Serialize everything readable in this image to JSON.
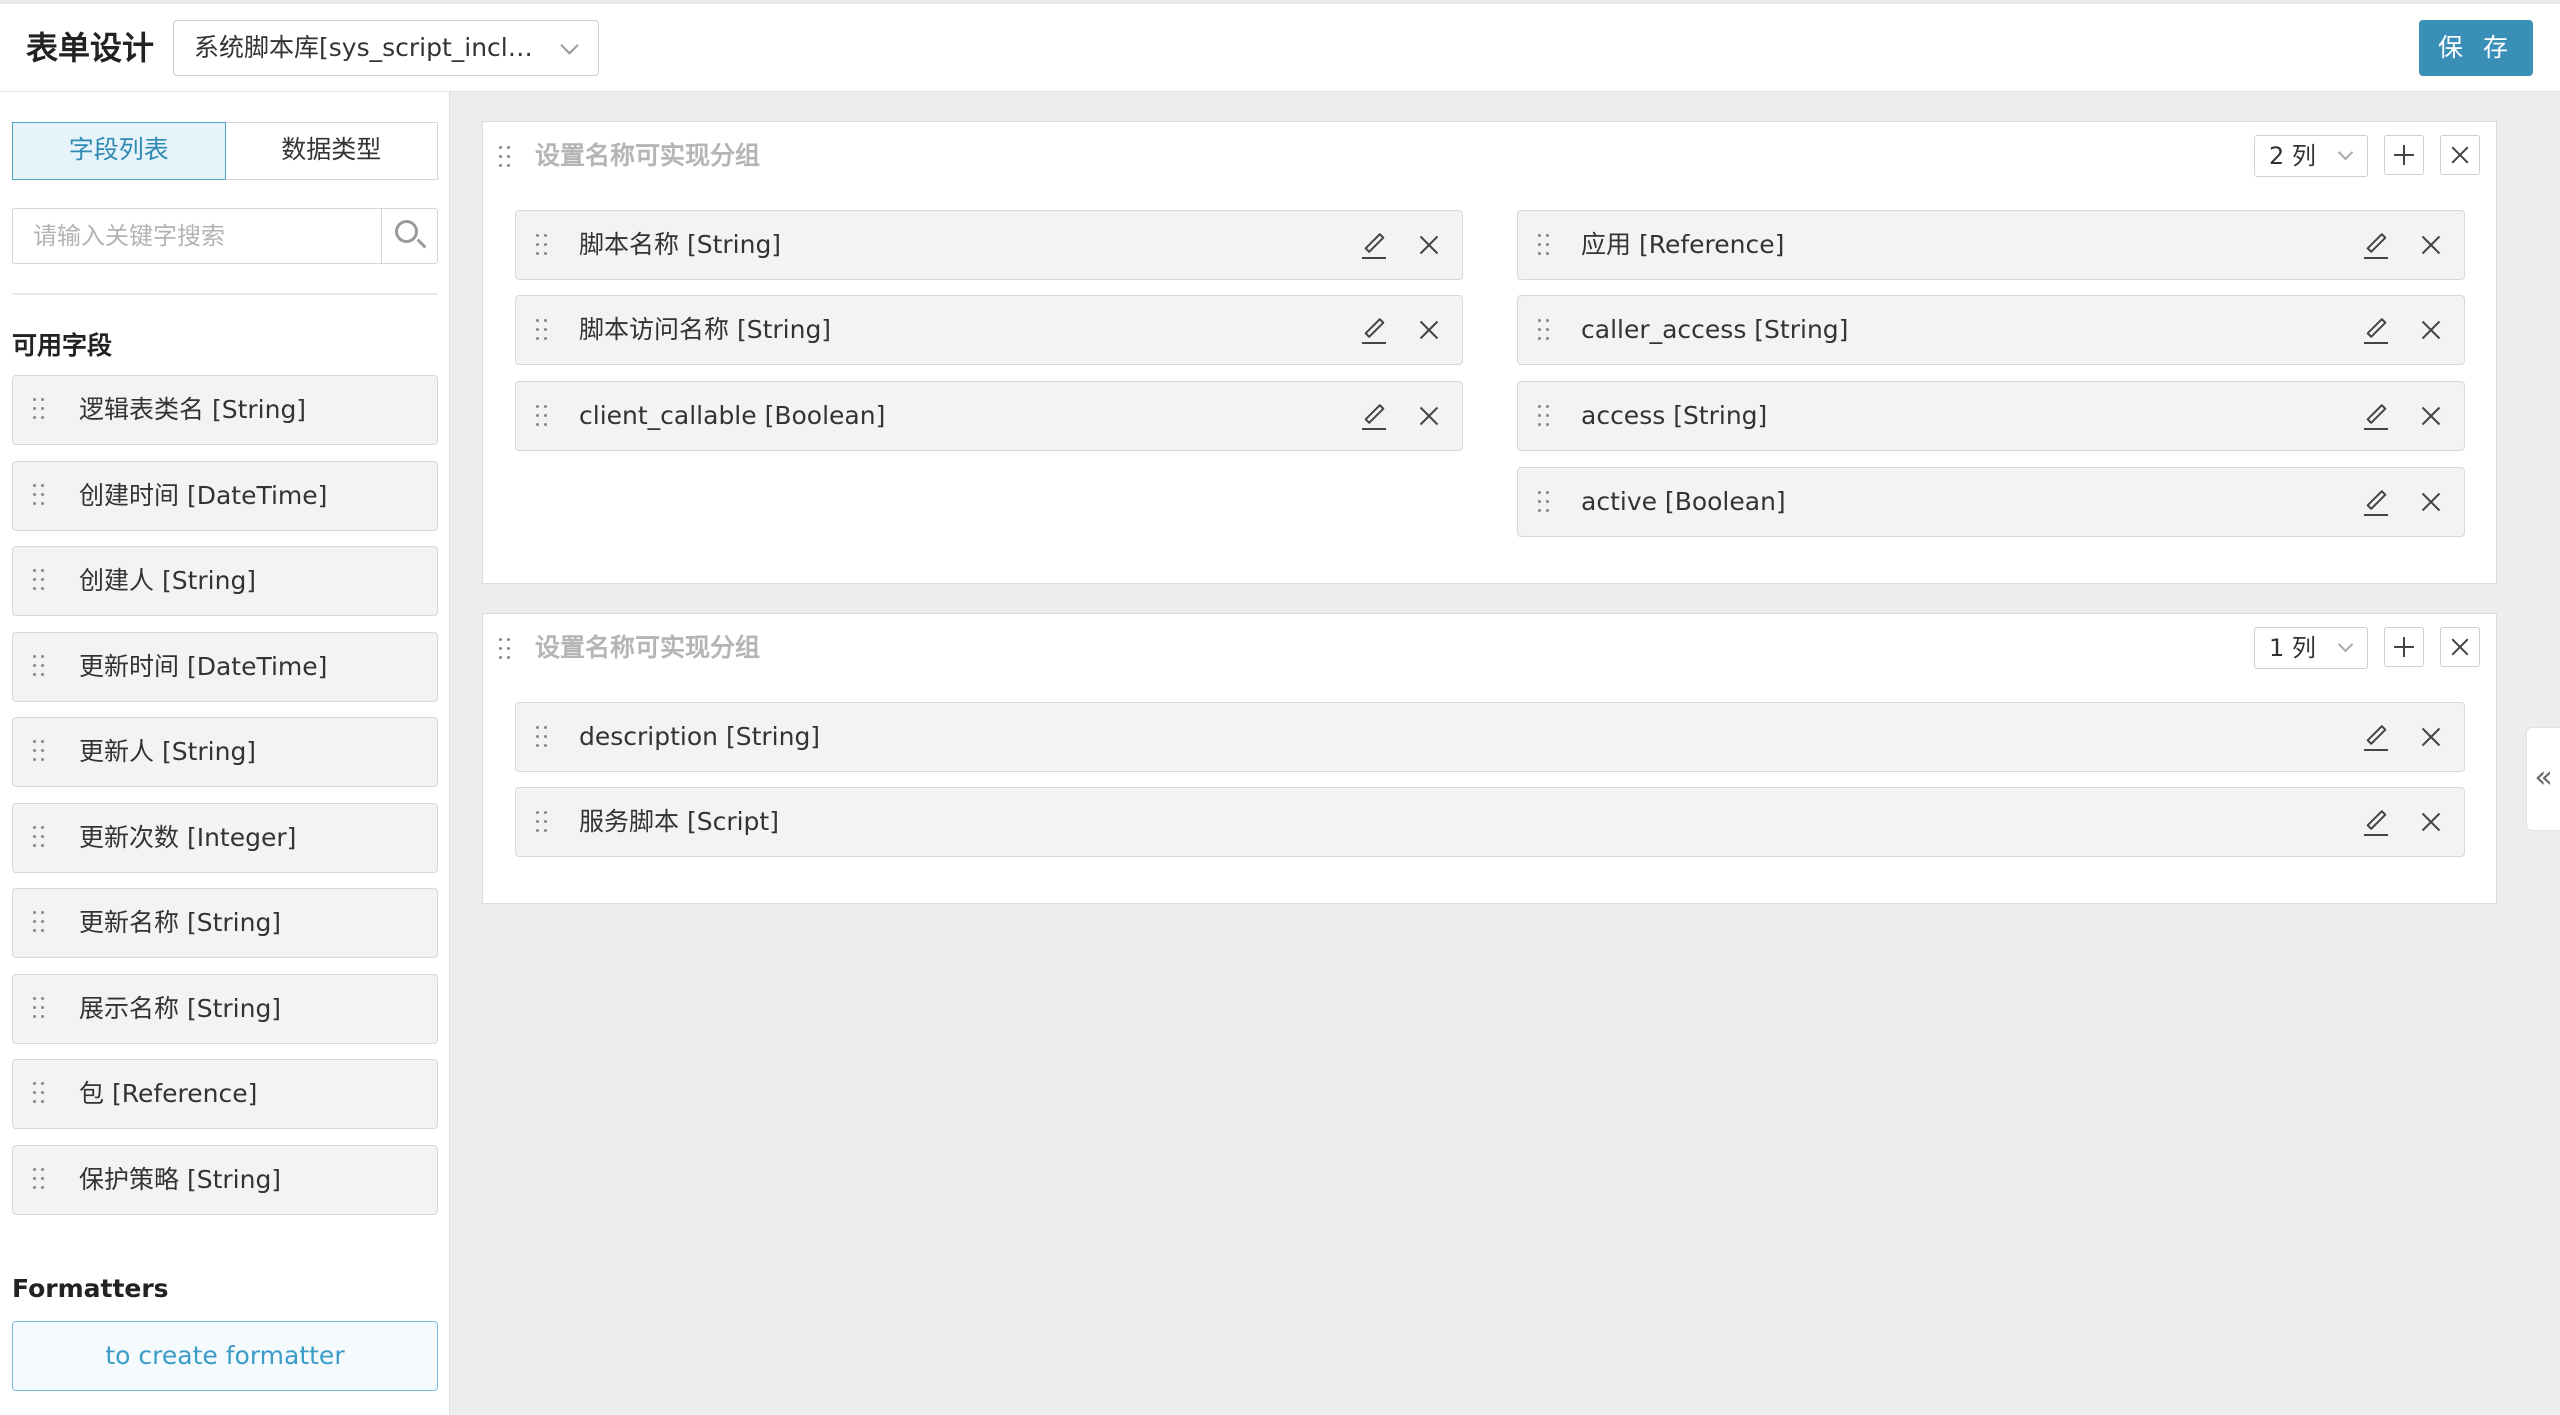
{
  "header": {
    "title": "表单设计",
    "form_select": "系统脚本库[sys_script_inclu...",
    "save_label": "保 存"
  },
  "sidebar": {
    "tabs": [
      {
        "label": "字段列表",
        "active": true
      },
      {
        "label": "数据类型",
        "active": false
      }
    ],
    "search_placeholder": "请输入关键字搜索",
    "available_title": "可用字段",
    "fields": [
      "逻辑表类名 [String]",
      "创建时间 [DateTime]",
      "创建人 [String]",
      "更新时间 [DateTime]",
      "更新人 [String]",
      "更新次数 [Integer]",
      "更新名称 [String]",
      "展示名称 [String]",
      "包 [Reference]",
      "保护策略 [String]"
    ],
    "formatters_title": "Formatters",
    "create_formatter_label": "to create formatter"
  },
  "groups": [
    {
      "title": "设置名称可实现分组",
      "columns": "2 列",
      "left": [
        "脚本名称 [String]",
        "脚本访问名称 [String]",
        "client_callable [Boolean]"
      ],
      "right": [
        "应用 [Reference]",
        "caller_access [String]",
        "access [String]",
        "active [Boolean]"
      ]
    },
    {
      "title": "设置名称可实现分组",
      "columns": "1 列",
      "left": [
        "description [String]",
        "服务脚本 [Script]"
      ]
    }
  ],
  "collapse_icon": "«",
  "colors": {
    "accent": "#3a8fb7",
    "tab_active_bg": "#e6f3fa",
    "tab_active_text": "#2e8ab3",
    "formatter_text": "#3a9cc7"
  }
}
